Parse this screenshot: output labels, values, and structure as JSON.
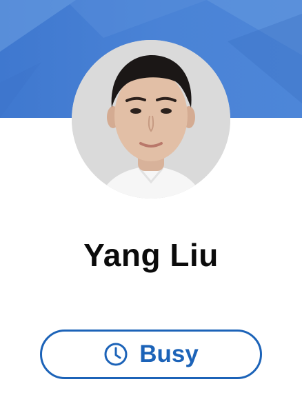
{
  "profile": {
    "name": "Yang Liu",
    "avatar_icon": "profile-photo",
    "status": {
      "label": "Busy",
      "icon": "clock-icon",
      "color": "#1c63b8"
    }
  },
  "theme": {
    "banner_color": "#4a83d6",
    "background": "#ffffff",
    "name_color": "#0b0b0b"
  }
}
